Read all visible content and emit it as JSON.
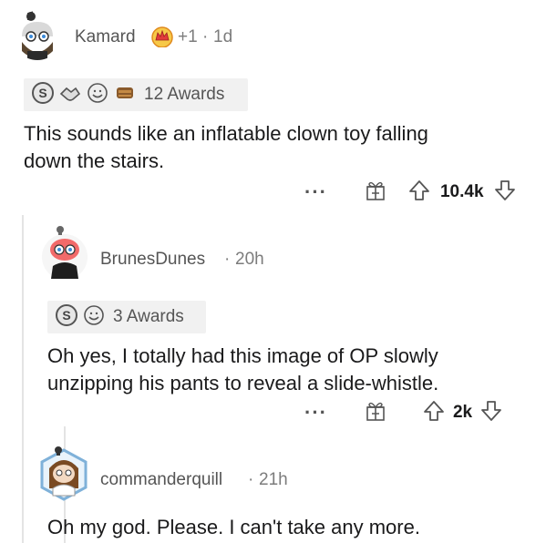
{
  "colors": {
    "text": "#1a1a1b",
    "muted": "#7c7c7c",
    "award_bg": "#f1f1f1",
    "thread_line": "#e4e4e4"
  },
  "comments": [
    {
      "username": "Kamard",
      "flair_icon": "crown-flair-icon",
      "score_delta": "+1",
      "separator": "·",
      "age": "1d",
      "awards_text": "12 Awards",
      "award_icons": [
        "silver-award-icon",
        "handshake-award-icon",
        "wholesome-award-icon",
        "helpful-award-icon"
      ],
      "body_lines": [
        "This sounds like an inflatable clown toy falling",
        "down the stairs."
      ],
      "more": "···",
      "votes": "10.4k"
    },
    {
      "username": "BrunesDunes",
      "separator": "·",
      "age": "20h",
      "awards_text": "3 Awards",
      "award_icons": [
        "silver-award-icon",
        "wholesome-award-icon"
      ],
      "body_lines": [
        "Oh yes, I totally had this image of OP slowly",
        "unzipping his pants to reveal a slide-whistle."
      ],
      "more": "···",
      "votes": "2k"
    },
    {
      "username": "commanderquill",
      "separator": "·",
      "age": "21h",
      "body_lines": [
        "Oh my god. Please. I can't take any more."
      ]
    }
  ]
}
